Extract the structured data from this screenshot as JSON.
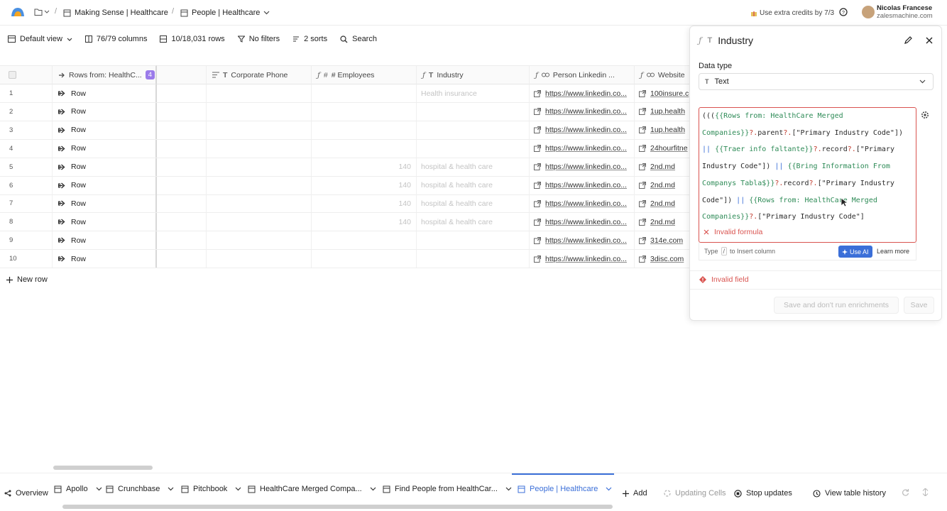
{
  "topbar": {
    "breadcrumb_workbook": "Making Sense | Healthcare",
    "breadcrumb_table": "People | Healthcare",
    "credits_text": "Use extra credits by 7/3",
    "user_name": "Nicolas Francese",
    "user_email": "zalesmachine.com"
  },
  "toolbar": {
    "view": "Default view",
    "columns": "76/79 columns",
    "rows": "10/18,031 rows",
    "filters": "No filters",
    "sorts": "2 sorts",
    "search": "Search"
  },
  "grid": {
    "headers": {
      "rows_from": "Rows from: HealthC...",
      "rows_from_badge": "4",
      "corporate_phone": "Corporate Phone",
      "employees": "# Employees",
      "industry": "Industry",
      "linkedin": "Person Linkedin ...",
      "website": "Website"
    },
    "rows": [
      {
        "n": "1",
        "row": "Row",
        "employees": "",
        "industry": "Health insurance",
        "linkedin": "https://www.linkedin.co...",
        "website": "100insure.c"
      },
      {
        "n": "2",
        "row": "Row",
        "employees": "",
        "industry": "",
        "linkedin": "https://www.linkedin.co...",
        "website": "1up.health"
      },
      {
        "n": "3",
        "row": "Row",
        "employees": "",
        "industry": "",
        "linkedin": "https://www.linkedin.co...",
        "website": "1up.health"
      },
      {
        "n": "4",
        "row": "Row",
        "employees": "",
        "industry": "",
        "linkedin": "https://www.linkedin.co...",
        "website": "24hourfitne"
      },
      {
        "n": "5",
        "row": "Row",
        "employees": "140",
        "industry": "hospital & health care",
        "linkedin": "https://www.linkedin.co...",
        "website": "2nd.md"
      },
      {
        "n": "6",
        "row": "Row",
        "employees": "140",
        "industry": "hospital & health care",
        "linkedin": "https://www.linkedin.co...",
        "website": "2nd.md"
      },
      {
        "n": "7",
        "row": "Row",
        "employees": "140",
        "industry": "hospital & health care",
        "linkedin": "https://www.linkedin.co...",
        "website": "2nd.md"
      },
      {
        "n": "8",
        "row": "Row",
        "employees": "140",
        "industry": "hospital & health care",
        "linkedin": "https://www.linkedin.co...",
        "website": "2nd.md"
      },
      {
        "n": "9",
        "row": "Row",
        "employees": "",
        "industry": "",
        "linkedin": "https://www.linkedin.co...",
        "website": "314e.com"
      },
      {
        "n": "10",
        "row": "Row",
        "employees": "",
        "industry": "",
        "linkedin": "https://www.linkedin.co...",
        "website": "3disc.com"
      }
    ],
    "new_row": "New row"
  },
  "panel": {
    "title": "Industry",
    "data_type_label": "Data type",
    "data_type_value": "Text",
    "formula_lines": [
      "((({{Rows from: HealthCare Merged",
      "Companies}}?.parent?.[\"Primary Industry Code\"])",
      "|| {{Traer info faltante}}?.record?.[\"Primary",
      "Industry Code\"]) || {{Bring Information From",
      "Companys Tabla$}}?.record?.[\"Primary Industry",
      "Code\"]) || {{Rows from: HealthCare Merged",
      "Companies}}?.[\"Primary Industry Code\"]"
    ],
    "invalid_formula": "Invalid formula",
    "hint_type": "Type",
    "hint_key": "/",
    "hint_rest": "to Insert column",
    "use_ai": "Use AI",
    "learn_more": "Learn more",
    "invalid_field": "Invalid field",
    "save_no_run": "Save and don't run enrichments",
    "save": "Save"
  },
  "bottombar": {
    "overview": "Overview",
    "tabs": [
      "Apollo",
      "Crunchbase",
      "Pitchbook",
      "HealthCare Merged Compa...",
      "Find People from HealthCar...",
      "People | Healthcare"
    ],
    "add": "Add",
    "updating": "Updating Cells",
    "stop": "Stop updates",
    "history": "View table history"
  },
  "colors": {
    "accent": "#3b6fd8",
    "error": "#d9534f",
    "badge": "#9b7bea"
  }
}
